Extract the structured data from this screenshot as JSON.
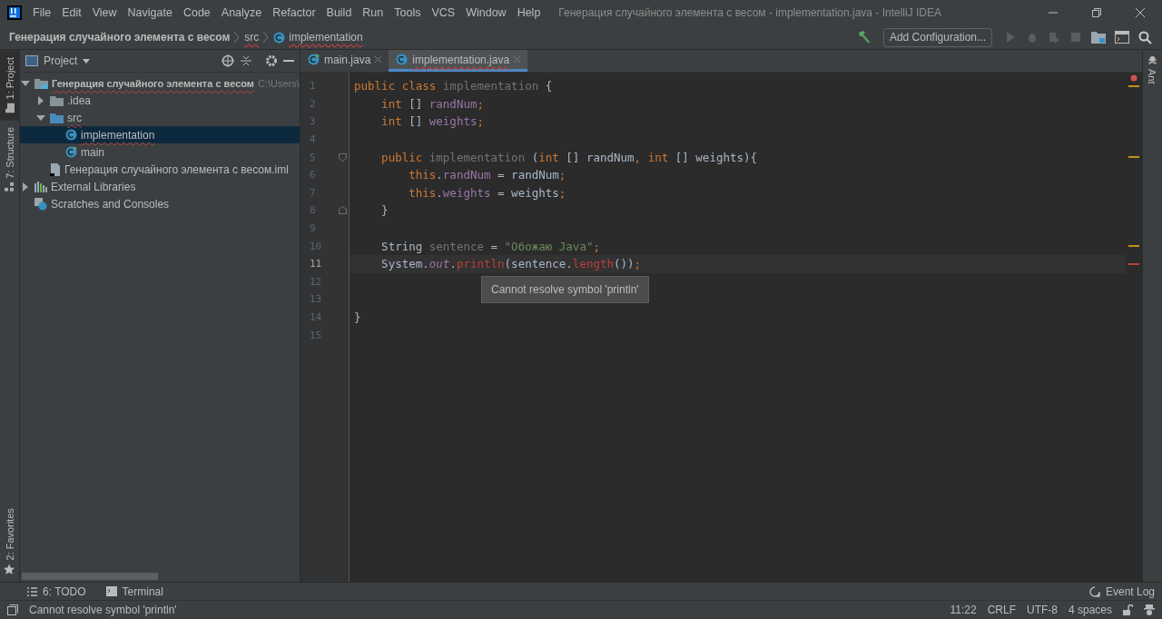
{
  "window": {
    "title": "Генерация случайного элемента с весом - implementation.java - IntelliJ IDEA"
  },
  "menu": [
    "File",
    "Edit",
    "View",
    "Navigate",
    "Code",
    "Analyze",
    "Refactor",
    "Build",
    "Run",
    "Tools",
    "VCS",
    "Window",
    "Help"
  ],
  "breadcrumbs": [
    {
      "label": "Генерация случайного элемента с весом",
      "kind": "project",
      "error": false
    },
    {
      "label": "src",
      "kind": "folder",
      "error": true
    },
    {
      "label": "implementation",
      "kind": "class",
      "error": true
    }
  ],
  "run_config": {
    "label": "Add Configuration..."
  },
  "left_stripe": [
    {
      "label": "1: Project",
      "selected": true,
      "kind": "folder"
    },
    {
      "label": "7: Structure",
      "selected": false,
      "kind": "structure"
    }
  ],
  "left_stripe_bottom": [
    {
      "label": "2: Favorites",
      "selected": false,
      "kind": "star"
    }
  ],
  "right_stripe": [
    {
      "label": "Ant",
      "selected": false
    }
  ],
  "project_panel": {
    "title": "Project",
    "tree": [
      {
        "label": "Генерация случайного элемента с весом",
        "path": "C:\\Users\\",
        "kind": "module",
        "expanded": true,
        "selected": false,
        "error": true,
        "children": [
          {
            "label": ".idea",
            "kind": "folder",
            "expanded": false,
            "selected": false,
            "error": false
          },
          {
            "label": "src",
            "kind": "source",
            "expanded": true,
            "selected": false,
            "error": true,
            "children": [
              {
                "label": "implementation",
                "kind": "class",
                "selected": true,
                "error": true
              },
              {
                "label": "main",
                "kind": "main",
                "selected": false,
                "error": false
              }
            ]
          },
          {
            "label": "Генерация случайного элемента с весом.iml",
            "kind": "file",
            "selected": false,
            "error": false
          }
        ]
      },
      {
        "label": "External Libraries",
        "kind": "libraries",
        "expanded": false,
        "selected": false,
        "error": false
      },
      {
        "label": "Scratches and Consoles",
        "kind": "scratches",
        "selected": false,
        "error": false
      }
    ]
  },
  "tabs": [
    {
      "label": "main.java",
      "kind": "main",
      "selected": false,
      "error": false
    },
    {
      "label": "implementation.java",
      "kind": "class",
      "selected": true,
      "error": true
    }
  ],
  "editor": {
    "tooltip": "Cannot resolve symbol 'println'",
    "lines": [
      {
        "number": "1",
        "current": false,
        "color": "#be9117",
        "tokens": [
          {
            "text": "public class ",
            "kind": "keyword"
          },
          {
            "text": "implementation ",
            "kind": "unused"
          },
          {
            "text": "{",
            "kind": "plain"
          }
        ]
      },
      {
        "number": "2",
        "current": false,
        "tokens": [
          {
            "text": "    int ",
            "kind": "keyword"
          },
          {
            "text": "[] ",
            "kind": "plain"
          },
          {
            "text": "randNum",
            "kind": "field"
          },
          {
            "text": ";",
            "kind": "keyword"
          }
        ]
      },
      {
        "number": "3",
        "current": false,
        "tokens": [
          {
            "text": "    int ",
            "kind": "keyword"
          },
          {
            "text": "[] ",
            "kind": "plain"
          },
          {
            "text": "weights",
            "kind": "field"
          },
          {
            "text": ";",
            "kind": "keyword"
          }
        ]
      },
      {
        "number": "4",
        "current": false
      },
      {
        "number": "5",
        "current": false,
        "fold_start": true,
        "color": "#be9117",
        "tokens": [
          {
            "text": "    public ",
            "kind": "keyword"
          },
          {
            "text": "implementation ",
            "kind": "unused"
          },
          {
            "text": "(",
            "kind": "plain"
          },
          {
            "text": "int ",
            "kind": "keyword"
          },
          {
            "text": "[] randNum",
            "kind": "plain"
          },
          {
            "text": ", ",
            "kind": "keyword"
          },
          {
            "text": "int ",
            "kind": "keyword"
          },
          {
            "text": "[] weights){",
            "kind": "plain"
          }
        ]
      },
      {
        "number": "6",
        "current": false,
        "tokens": [
          {
            "text": "        this",
            "kind": "keyword"
          },
          {
            "text": ".",
            "kind": "plain"
          },
          {
            "text": "randNum",
            "kind": "field"
          },
          {
            "text": " = randNum",
            "kind": "plain"
          },
          {
            "text": ";",
            "kind": "keyword"
          }
        ]
      },
      {
        "number": "7",
        "current": false,
        "tokens": [
          {
            "text": "        this",
            "kind": "keyword"
          },
          {
            "text": ".",
            "kind": "plain"
          },
          {
            "text": "weights",
            "kind": "field"
          },
          {
            "text": " = weights",
            "kind": "plain"
          },
          {
            "text": ";",
            "kind": "keyword"
          }
        ]
      },
      {
        "number": "8",
        "current": false,
        "fold_end": true,
        "tokens": [
          {
            "text": "    }",
            "kind": "plain"
          }
        ]
      },
      {
        "number": "9",
        "current": false
      },
      {
        "number": "10",
        "current": false,
        "color": "#be9117",
        "tokens": [
          {
            "text": "    String ",
            "kind": "plain"
          },
          {
            "text": "sentence",
            "kind": "unused"
          },
          {
            "text": " = ",
            "kind": "plain"
          },
          {
            "text": "\"Обожаю Java\"",
            "kind": "string"
          },
          {
            "text": ";",
            "kind": "keyword"
          }
        ]
      },
      {
        "number": "11",
        "current": true,
        "color": "#bc3f3c",
        "tokens": [
          {
            "text": "    System.",
            "kind": "plain"
          },
          {
            "text": "out",
            "kind": "static"
          },
          {
            "text": ".",
            "kind": "plain"
          },
          {
            "text": "println",
            "kind": "error"
          },
          {
            "text": "(sentence.",
            "kind": "plain"
          },
          {
            "text": "length",
            "kind": "error"
          },
          {
            "text": "())",
            "kind": "plain"
          },
          {
            "text": ";",
            "kind": "keyword"
          }
        ]
      },
      {
        "number": "12",
        "current": false
      },
      {
        "number": "13",
        "current": false
      },
      {
        "number": "14",
        "current": false,
        "tokens": [
          {
            "text": "}",
            "kind": "plain"
          }
        ]
      },
      {
        "number": "15",
        "current": false
      }
    ]
  },
  "bottom_tools": [
    {
      "label": "6: TODO",
      "kind": "todo"
    },
    {
      "label": "Terminal",
      "kind": "terminal"
    }
  ],
  "event_log": {
    "label": "Event Log"
  },
  "status_bar": {
    "message": "Cannot resolve symbol 'println'",
    "items": [
      "11:22",
      "CRLF",
      "UTF-8",
      "4 spaces"
    ]
  }
}
